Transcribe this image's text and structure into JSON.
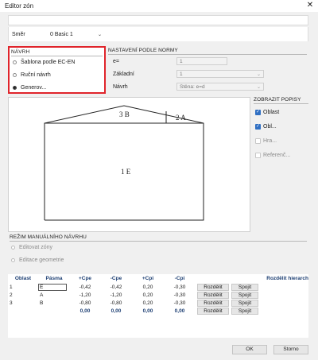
{
  "window": {
    "title": "Editor zón",
    "close_glyph": "✕"
  },
  "top": {
    "smer_label": "Směr",
    "smer_value": "0 Basic 1"
  },
  "navrh": {
    "header": "NÁVRH",
    "options": [
      {
        "label": "Šablona podle EC-EN",
        "selected": false
      },
      {
        "label": "Ruční návrh",
        "selected": false
      },
      {
        "label": "Generov...",
        "selected": true
      }
    ]
  },
  "nastaveni": {
    "header": "NASTAVENÍ PODLE NORMY",
    "rows": [
      {
        "label": "e=",
        "value": "1"
      },
      {
        "label": "Základní",
        "value": "1"
      },
      {
        "label": "Návrh",
        "value": "Stěna: e=d"
      }
    ]
  },
  "zobrazit": {
    "header": "ZOBRAZIT POPISY",
    "items": [
      {
        "label": "Oblast",
        "checked": true
      },
      {
        "label": "Obl...",
        "checked": true
      },
      {
        "label": "Hra...",
        "checked": false
      },
      {
        "label": "Referenč...",
        "checked": false
      }
    ]
  },
  "drawing": {
    "zones": [
      "3 B",
      "2 A",
      "1 E"
    ]
  },
  "manual": {
    "header": "REŽIM MANUÁLNÍHO NÁVRHU",
    "options": [
      "Editovat zóny",
      "Editace geometrie"
    ]
  },
  "table": {
    "headers": [
      "Oblast",
      "Pásma",
      "+Cpe",
      "-Cpe",
      "+Cpi",
      "-Cpi",
      "",
      "",
      "Rozdělit hierarch"
    ],
    "rows": [
      {
        "oblast": "1",
        "pasma": "E",
        "pcpe": "-0,42",
        "mcpe": "-0,42",
        "pcpi": "0,20",
        "mcpi": "-0,30"
      },
      {
        "oblast": "2",
        "pasma": "A",
        "pcpe": "-1,20",
        "mcpe": "-1,20",
        "pcpi": "0,20",
        "mcpi": "-0,30"
      },
      {
        "oblast": "3",
        "pasma": "B",
        "pcpe": "-0,80",
        "mcpe": "-0,80",
        "pcpi": "0,20",
        "mcpi": "-0,30"
      }
    ],
    "total": {
      "pcpe": "0,00",
      "mcpe": "0,00",
      "pcpi": "0,00",
      "mcpi": "0,00"
    },
    "split_label": "Rozdělit",
    "join_label": "Spojit"
  },
  "footer": {
    "ok": "OK",
    "cancel": "Storno"
  },
  "colors": {
    "highlight": "#e0242b",
    "checkbox": "#2f6fc3",
    "header_text": "#1d3f73"
  },
  "icons": {
    "close": "close-icon",
    "dropdown": "chevron-down-icon",
    "checkbox": "checkbox-icon",
    "radio": "radio-icon"
  }
}
